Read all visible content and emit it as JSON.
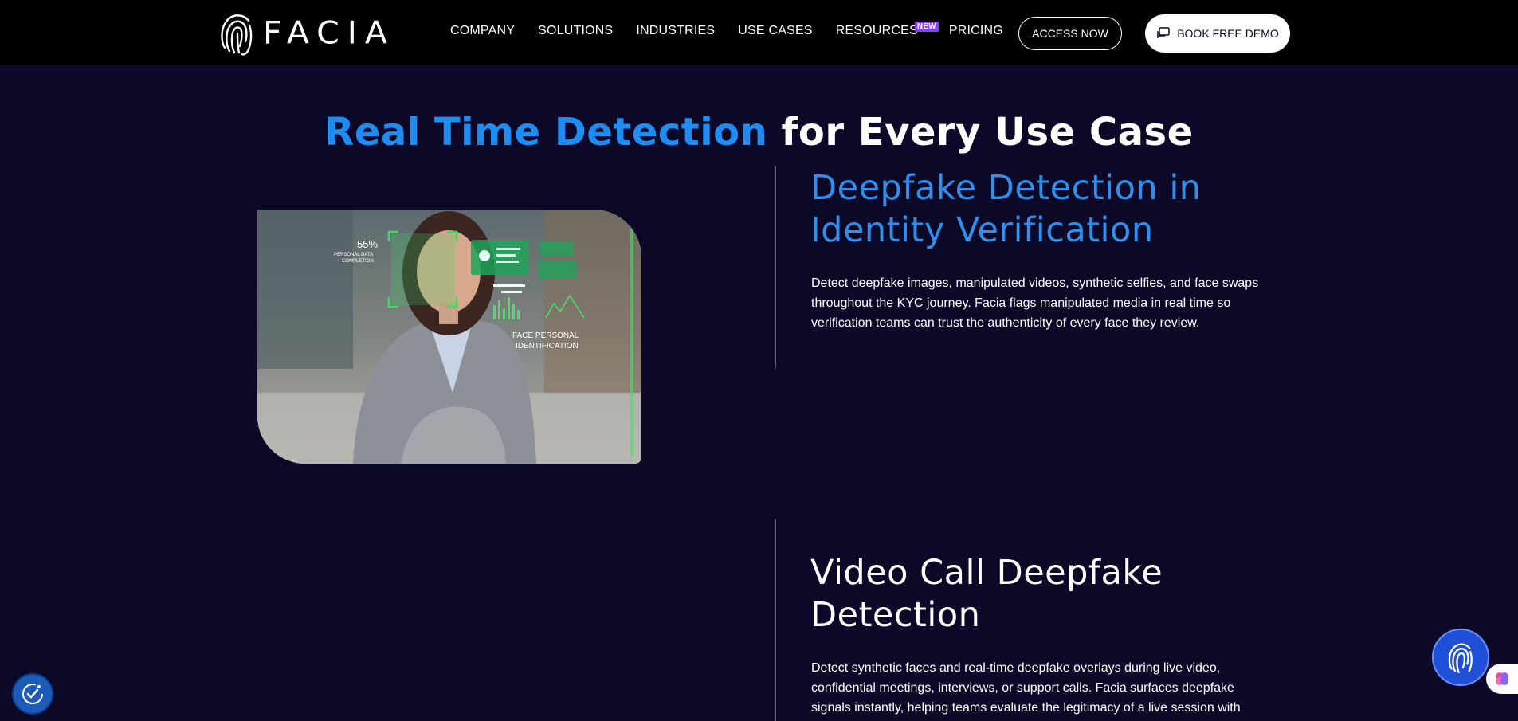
{
  "nav": {
    "logo_text": "FACIA",
    "items": [
      {
        "label": "COMPANY"
      },
      {
        "label": "SOLUTIONS"
      },
      {
        "label": "INDUSTRIES"
      },
      {
        "label": "USE CASES"
      },
      {
        "label": "RESOURCES",
        "badge": "NEW"
      },
      {
        "label": "PRICING"
      }
    ],
    "access_label": "ACCESS NOW",
    "demo_label": "BOOK FREE DEMO",
    "demo_icon": "chat-bubbles-icon"
  },
  "main": {
    "title_highlight": "Real Time Detection",
    "title_rest": "for Every Use Case",
    "sections": [
      {
        "title": "Deepfake Detection in Identity Verification",
        "text": "Detect deepfake images, manipulated videos, synthetic selfies, and face swaps throughout the KYC journey. Facia flags manipulated media in real time so verification teams can trust the authenticity of every face they review."
      },
      {
        "title": "Video Call Deepfake Detection",
        "text": "Detect synthetic faces and real-time deepfake overlays during live video, confidential meetings, interviews, or support calls. Facia surfaces deepfake signals instantly, helping teams evaluate the legitimacy of a live session with"
      }
    ],
    "photo": {
      "percent": "55%",
      "percent_caption_1": "PERSONAL DATA",
      "percent_caption_2": "COMPLETION",
      "caption_1": "FACE PERSONAL",
      "caption_2": "IDENTIFICATION"
    }
  },
  "floating": {
    "accessibility_icon": "accessibility-icon",
    "chat_icon": "fingerprint-icon",
    "side_icon": "brain-icon"
  },
  "colors": {
    "background": "#0b0828",
    "accent_blue": "#1e8cf0",
    "nav_bg": "#000000",
    "badge": "#8b3dff"
  }
}
